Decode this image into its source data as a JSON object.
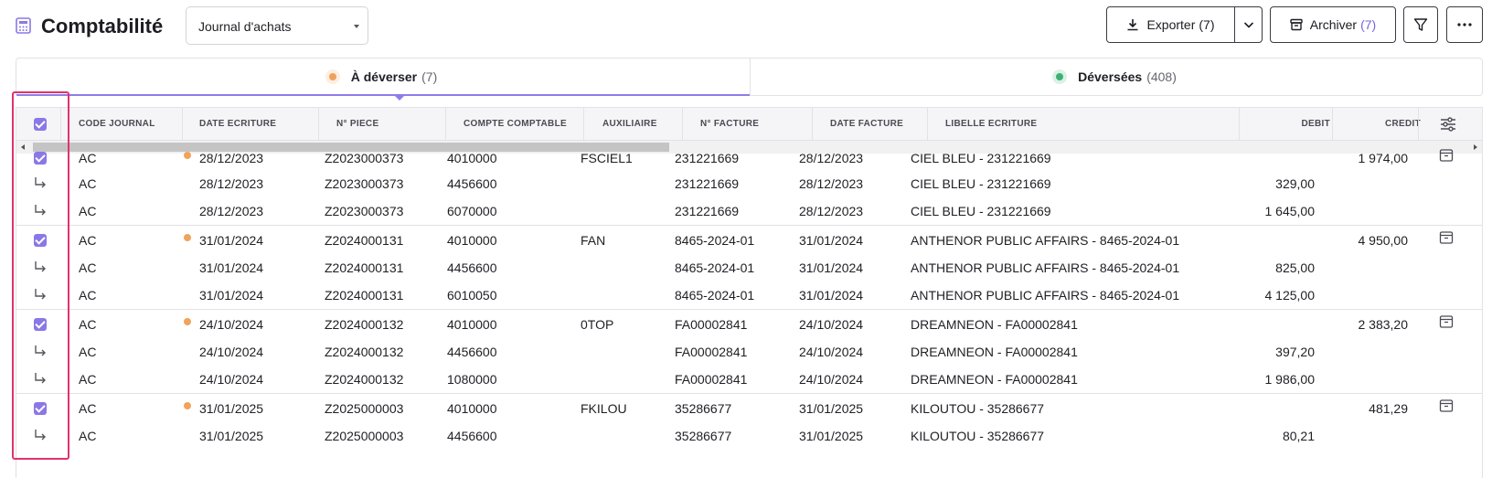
{
  "header": {
    "title": "Comptabilité",
    "journal_select": {
      "value": "Journal d'achats"
    },
    "export": {
      "label": "Exporter",
      "count": "(7)"
    },
    "archive": {
      "label": "Archiver",
      "count": "(7)"
    },
    "icons": [
      "calculator-icon",
      "download-icon",
      "chevron-down-icon",
      "archive-icon",
      "filter-icon",
      "more-icon"
    ]
  },
  "tabs": [
    {
      "label": "À déverser",
      "count": "(7)",
      "dot_color": "#f0a35a",
      "active": true
    },
    {
      "label": "Déversées",
      "count": "(408)",
      "dot_color": "#3bb273",
      "active": false
    }
  ],
  "table": {
    "columns": {
      "code_journal": "CODE JOURNAL",
      "date_ecriture": "DATE ECRITURE",
      "n_piece": "N° PIECE",
      "compte": "COMPTE COMPTABLE",
      "auxiliaire": "AUXILIAIRE",
      "n_facture": "N° FACTURE",
      "date_facture": "DATE FACTURE",
      "libelle": "LIBELLE ECRITURE",
      "debit": "DEBIT",
      "credit": "CREDIT"
    },
    "rows": [
      {
        "type": "main",
        "code": "AC",
        "date": "28/12/2023",
        "piece": "Z2023000373",
        "compte": "4010000",
        "aux": "FSCIEL1",
        "facture": "231221669",
        "date_facture": "28/12/2023",
        "libelle": "CIEL BLEU - 231221669",
        "debit": "",
        "credit": "1 974,00"
      },
      {
        "type": "sub",
        "code": "AC",
        "date": "28/12/2023",
        "piece": "Z2023000373",
        "compte": "4456600",
        "aux": "",
        "facture": "231221669",
        "date_facture": "28/12/2023",
        "libelle": "CIEL BLEU - 231221669",
        "debit": "329,00",
        "credit": ""
      },
      {
        "type": "sub",
        "code": "AC",
        "date": "28/12/2023",
        "piece": "Z2023000373",
        "compte": "6070000",
        "aux": "",
        "facture": "231221669",
        "date_facture": "28/12/2023",
        "libelle": "CIEL BLEU - 231221669",
        "debit": "1 645,00",
        "credit": ""
      },
      {
        "type": "main",
        "code": "AC",
        "date": "31/01/2024",
        "piece": "Z2024000131",
        "compte": "4010000",
        "aux": "FAN",
        "facture": "8465-2024-01",
        "date_facture": "31/01/2024",
        "libelle": "ANTHENOR PUBLIC AFFAIRS - 8465-2024-01",
        "debit": "",
        "credit": "4 950,00"
      },
      {
        "type": "sub",
        "code": "AC",
        "date": "31/01/2024",
        "piece": "Z2024000131",
        "compte": "4456600",
        "aux": "",
        "facture": "8465-2024-01",
        "date_facture": "31/01/2024",
        "libelle": "ANTHENOR PUBLIC AFFAIRS - 8465-2024-01",
        "debit": "825,00",
        "credit": ""
      },
      {
        "type": "sub",
        "code": "AC",
        "date": "31/01/2024",
        "piece": "Z2024000131",
        "compte": "6010050",
        "aux": "",
        "facture": "8465-2024-01",
        "date_facture": "31/01/2024",
        "libelle": "ANTHENOR PUBLIC AFFAIRS - 8465-2024-01",
        "debit": "4 125,00",
        "credit": ""
      },
      {
        "type": "main",
        "code": "AC",
        "date": "24/10/2024",
        "piece": "Z2024000132",
        "compte": "4010000",
        "aux": "0TOP",
        "facture": "FA00002841",
        "date_facture": "24/10/2024",
        "libelle": "DREAMNEON - FA00002841",
        "debit": "",
        "credit": "2 383,20"
      },
      {
        "type": "sub",
        "code": "AC",
        "date": "24/10/2024",
        "piece": "Z2024000132",
        "compte": "4456600",
        "aux": "",
        "facture": "FA00002841",
        "date_facture": "24/10/2024",
        "libelle": "DREAMNEON - FA00002841",
        "debit": "397,20",
        "credit": ""
      },
      {
        "type": "sub",
        "code": "AC",
        "date": "24/10/2024",
        "piece": "Z2024000132",
        "compte": "1080000",
        "aux": "",
        "facture": "FA00002841",
        "date_facture": "24/10/2024",
        "libelle": "DREAMNEON - FA00002841",
        "debit": "1 986,00",
        "credit": ""
      },
      {
        "type": "main",
        "code": "AC",
        "date": "31/01/2025",
        "piece": "Z2025000003",
        "compte": "4010000",
        "aux": "FKILOU",
        "facture": "35286677",
        "date_facture": "31/01/2025",
        "libelle": "KILOUTOU - 35286677",
        "debit": "",
        "credit": "481,29"
      },
      {
        "type": "sub",
        "code": "AC",
        "date": "31/01/2025",
        "piece": "Z2025000003",
        "compte": "4456600",
        "aux": "",
        "facture": "35286677",
        "date_facture": "31/01/2025",
        "libelle": "KILOUTOU - 35286677",
        "debit": "80,21",
        "credit": ""
      }
    ]
  },
  "colors": {
    "accent": "#8b78e6",
    "pending_dot": "#f0a35a",
    "done_dot": "#3bb273",
    "highlight": "#e0336b"
  }
}
